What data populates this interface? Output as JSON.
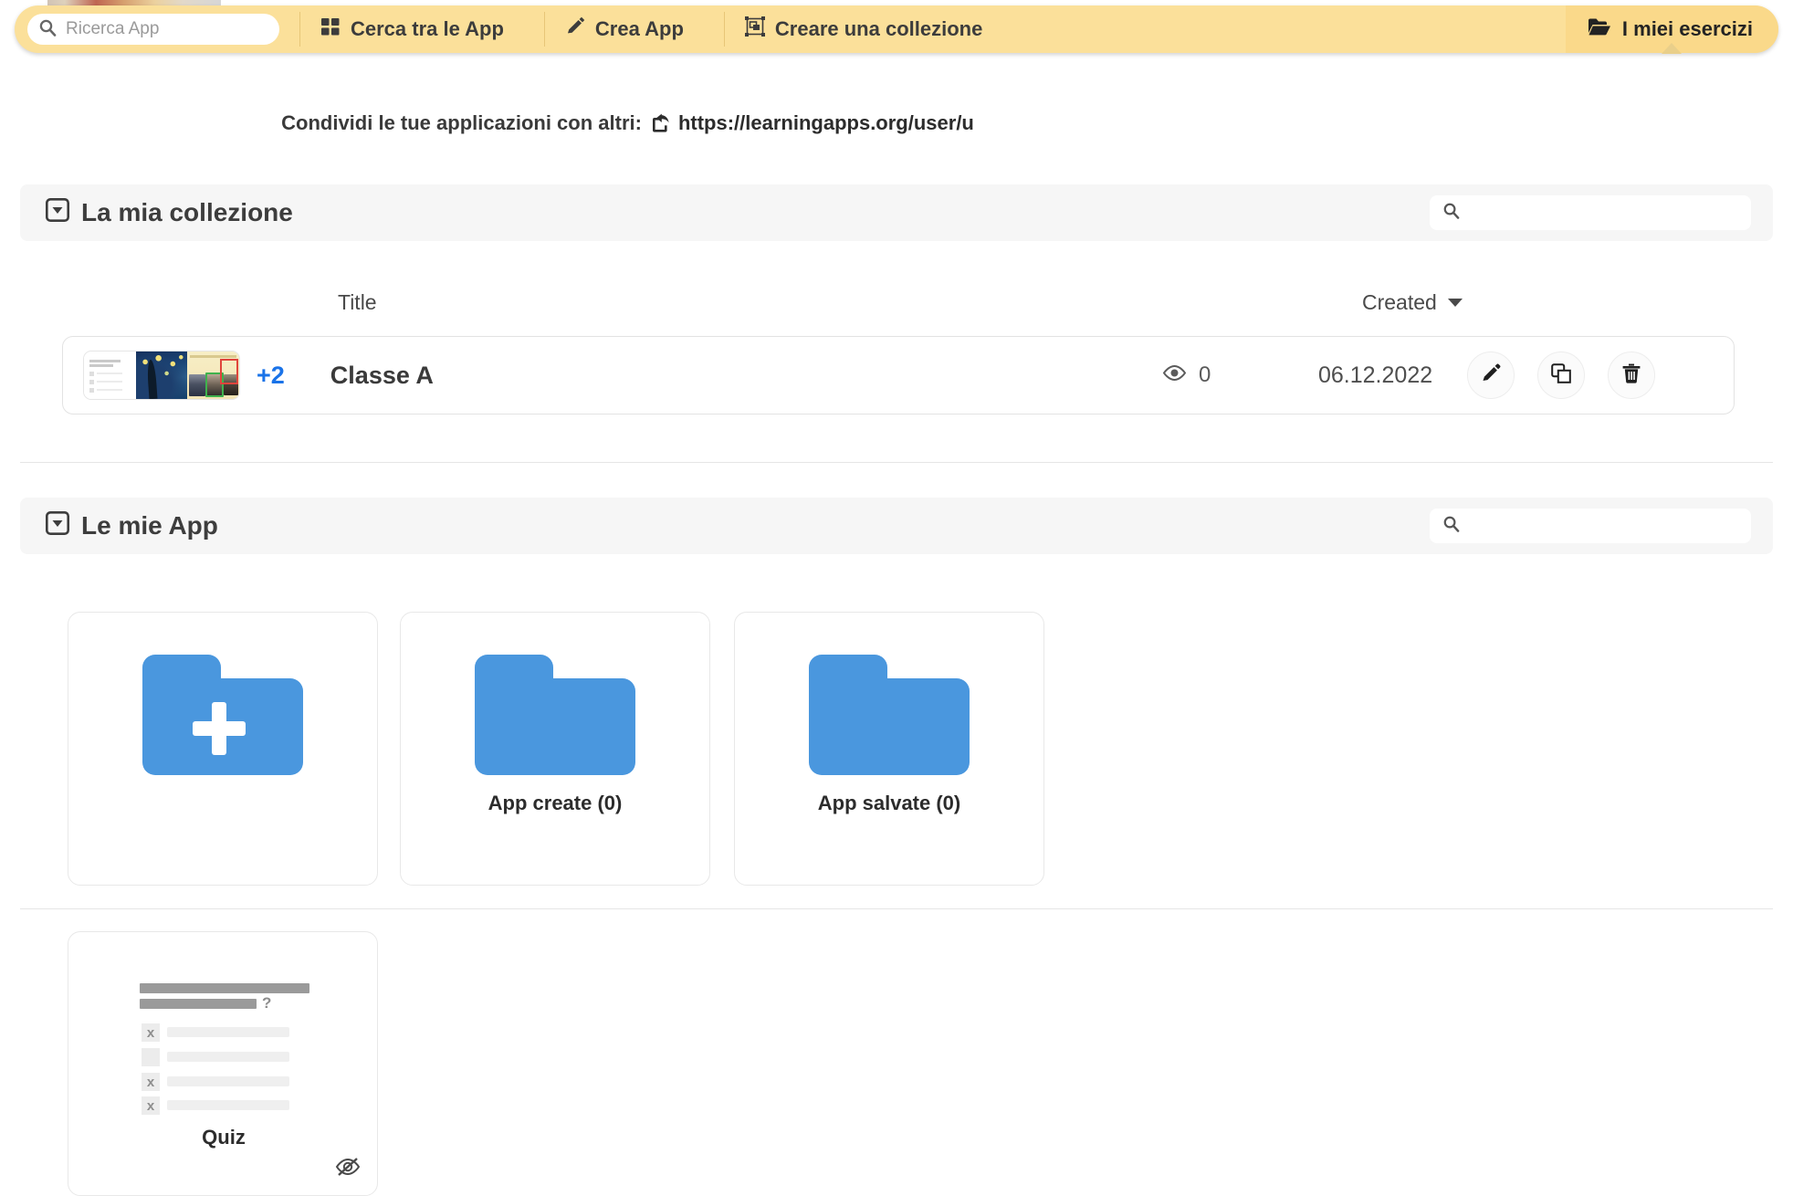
{
  "toolbar": {
    "search_placeholder": "Ricerca App",
    "search_value": "",
    "search_icon": "search-icon",
    "items": [
      {
        "label": "Cerca tra le App",
        "icon": "grid-icon"
      },
      {
        "label": "Crea App",
        "icon": "pencil-icon"
      },
      {
        "label": "Creare una collezione",
        "icon": "collection-icon"
      }
    ],
    "my_exercises": {
      "label": "I miei esercizi",
      "icon": "open-folder-icon"
    },
    "bg_color": "#fbe09a",
    "active_bg_color": "#fad98a"
  },
  "share": {
    "label": "Condividi le tue applicazioni con altri:",
    "icon": "external-link-icon",
    "url": "https://learningapps.org/user/u"
  },
  "collection_section": {
    "title": "La mia collezione",
    "collapse_icon": "collapse-box-icon",
    "search_placeholder": "",
    "search_value": "",
    "search_icon": "search-icon",
    "columns": {
      "title": "Title",
      "created": "Created",
      "sort_icon": "caret-down-icon"
    },
    "rows": [
      {
        "title": "Classe A",
        "extra_count": "+2",
        "views": "0",
        "views_icon": "eye-icon",
        "created": "06.12.2022",
        "actions": [
          {
            "name": "edit-button",
            "icon": "pencil-icon"
          },
          {
            "name": "copy-button",
            "icon": "copy-icon"
          },
          {
            "name": "delete-button",
            "icon": "trash-icon"
          }
        ],
        "thumbnails": [
          "quiz-thumbnail",
          "starry-night-thumbnail",
          "photo-gallery-thumbnail"
        ]
      }
    ]
  },
  "apps_section": {
    "title": "Le mie App",
    "collapse_icon": "collapse-box-icon",
    "search_placeholder": "",
    "search_value": "",
    "search_icon": "search-icon",
    "folder_color": "#4a97de",
    "cards": [
      {
        "label": "",
        "icon": "new-folder-icon"
      },
      {
        "label": "App create (0)",
        "icon": "folder-icon"
      },
      {
        "label": "App salvate (0)",
        "icon": "folder-icon"
      }
    ],
    "apps": [
      {
        "label": "Quiz",
        "thumbnail": "quiz-thumbnail",
        "hidden_icon": "eye-slash-icon"
      }
    ]
  },
  "accent_color": "#1a73e8"
}
